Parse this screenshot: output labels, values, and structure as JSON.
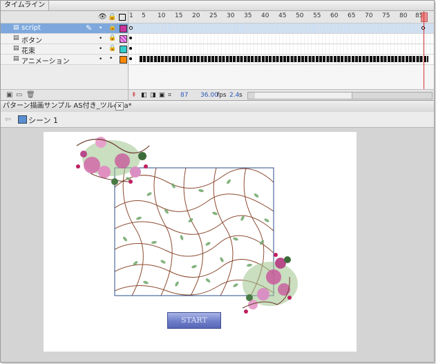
{
  "timeline": {
    "tab_label": "タイムライン",
    "layers": [
      {
        "name": "script",
        "color": "#c8359a",
        "selected": true
      },
      {
        "name": "ボタン",
        "color": "#cc44cc",
        "selected": false
      },
      {
        "name": "花束",
        "color": "#33cccc",
        "selected": false
      },
      {
        "name": "アニメーション",
        "color": "#ff8800",
        "selected": false
      }
    ],
    "ruler_ticks": [
      "1",
      "5",
      "10",
      "15",
      "20",
      "25",
      "30",
      "35",
      "40",
      "45",
      "50",
      "55",
      "60",
      "65",
      "70",
      "75",
      "80",
      "85"
    ],
    "current_frame": "87",
    "fps": "36.00",
    "fps_unit": "fps",
    "elapsed": "2.4",
    "elapsed_unit": "s"
  },
  "document": {
    "tab_label": "パターン描画サンプル AS付き_ツルc.fla*",
    "scene_label": "シーン 1"
  },
  "stage": {
    "start_button_label": "START"
  }
}
